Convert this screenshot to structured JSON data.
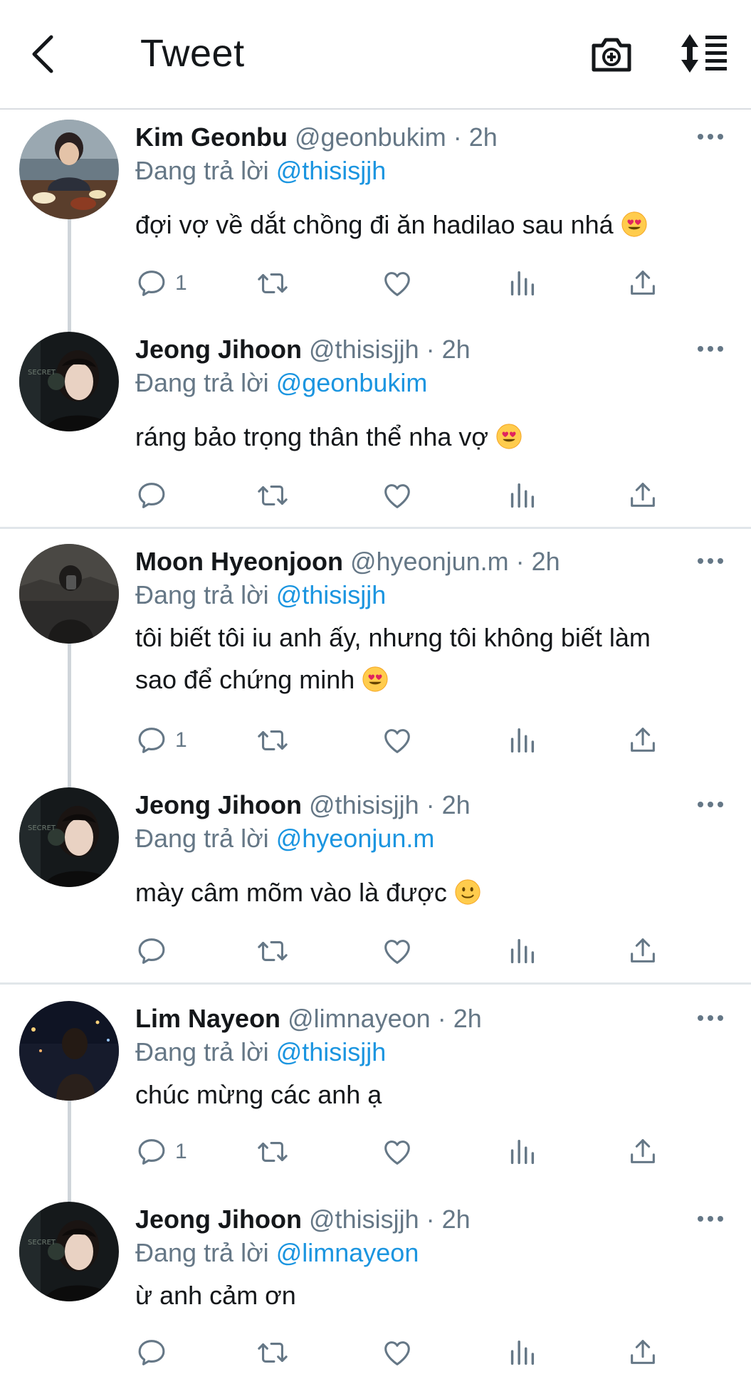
{
  "header": {
    "title": "Tweet",
    "back_icon": "back-arrow-icon",
    "camera_icon": "camera-icon",
    "sort_icon": "sort-icon"
  },
  "colors": {
    "link": "#1b95e0",
    "muted": "#657786",
    "text": "#14171a",
    "divider": "#e1e6ea"
  },
  "replies": [
    {
      "name": "Kim Geonbu",
      "handle": "@geonbukim",
      "time": "2h",
      "replying_to_label": "Đang trả lời",
      "replying_to": "@thisisjjh",
      "text": "đợi vợ về dắt chồng đi ăn hadilao sau nhá",
      "emoji": "heart-eyes-emoji",
      "reply_count": "1"
    },
    {
      "name": "Jeong Jihoon",
      "handle": "@thisisjjh",
      "time": "2h",
      "replying_to_label": "Đang trả lời",
      "replying_to": "@geonbukim",
      "text": "ráng bảo trọng thân thể nha vợ",
      "emoji": "heart-eyes-emoji",
      "reply_count": ""
    },
    {
      "name": "Moon Hyeonjoon",
      "handle": "@hyeonjun.m",
      "time": "2h",
      "replying_to_label": "Đang trả lời",
      "replying_to": "@thisisjjh",
      "text_line1": "tôi biết tôi iu anh ấy, nhưng tôi không biết làm",
      "text_line2": "sao để chứng minh",
      "emoji": "heart-eyes-emoji",
      "reply_count": "1"
    },
    {
      "name": "Jeong Jihoon",
      "handle": "@thisisjjh",
      "time": "2h",
      "replying_to_label": "Đang trả lời",
      "replying_to": "@hyeonjun.m",
      "text": "mày câm mõm vào là được",
      "emoji": "slight-smile-emoji",
      "reply_count": ""
    },
    {
      "name": "Lim Nayeon",
      "handle": "@limnayeon",
      "time": "2h",
      "replying_to_label": "Đang trả lời",
      "replying_to": "@thisisjjh",
      "text": "chúc mừng các anh ạ",
      "emoji": "",
      "reply_count": "1"
    },
    {
      "name": "Jeong Jihoon",
      "handle": "@thisisjjh",
      "time": "2h",
      "replying_to_label": "Đang trả lời",
      "replying_to": "@limnayeon",
      "text": "ừ anh cảm ơn",
      "emoji": "",
      "reply_count": ""
    }
  ]
}
